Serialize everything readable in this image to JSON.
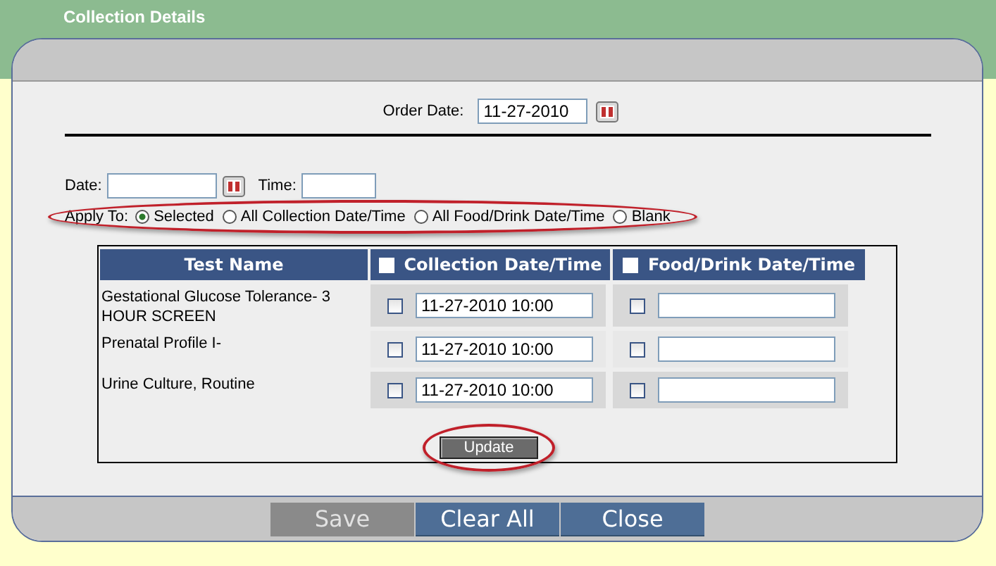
{
  "page_title": "Collection Details",
  "order_date": {
    "label": "Order Date:",
    "value": "11-27-2010"
  },
  "date": {
    "label": "Date:"
  },
  "time": {
    "label": "Time:"
  },
  "apply_to": {
    "label": "Apply To:",
    "highlighted": true,
    "options": [
      {
        "label": "Selected",
        "selected": true
      },
      {
        "label": "All Collection Date/Time",
        "selected": false
      },
      {
        "label": "All Food/Drink Date/Time",
        "selected": false
      },
      {
        "label": "Blank",
        "selected": false
      }
    ]
  },
  "table": {
    "columns": [
      {
        "label": "Test Name",
        "kind": "text"
      },
      {
        "label": "Collection Date/Time",
        "kind": "check",
        "checked": false
      },
      {
        "label": "Food/Drink Date/Time",
        "kind": "check",
        "checked": false
      }
    ],
    "rows": [
      {
        "test_name": "Gestational Glucose Tolerance- 3 HOUR SCREEN",
        "collection": {
          "checked": false,
          "value": "11-27-2010 10:00"
        },
        "food": {
          "checked": false
        }
      },
      {
        "test_name": "Prenatal Profile I-",
        "collection": {
          "checked": false,
          "value": "11-27-2010 10:00"
        },
        "food": {
          "checked": false
        }
      },
      {
        "test_name": "Urine Culture, Routine",
        "collection": {
          "checked": false,
          "value": "11-27-2010 10:00"
        },
        "food": {
          "checked": false
        }
      }
    ]
  },
  "update_button": {
    "label": "Update",
    "highlighted": true
  },
  "footer_buttons": [
    {
      "label": "Save",
      "disabled": true
    },
    {
      "label": "Clear All",
      "disabled": false
    },
    {
      "label": "Close",
      "disabled": false
    }
  ]
}
